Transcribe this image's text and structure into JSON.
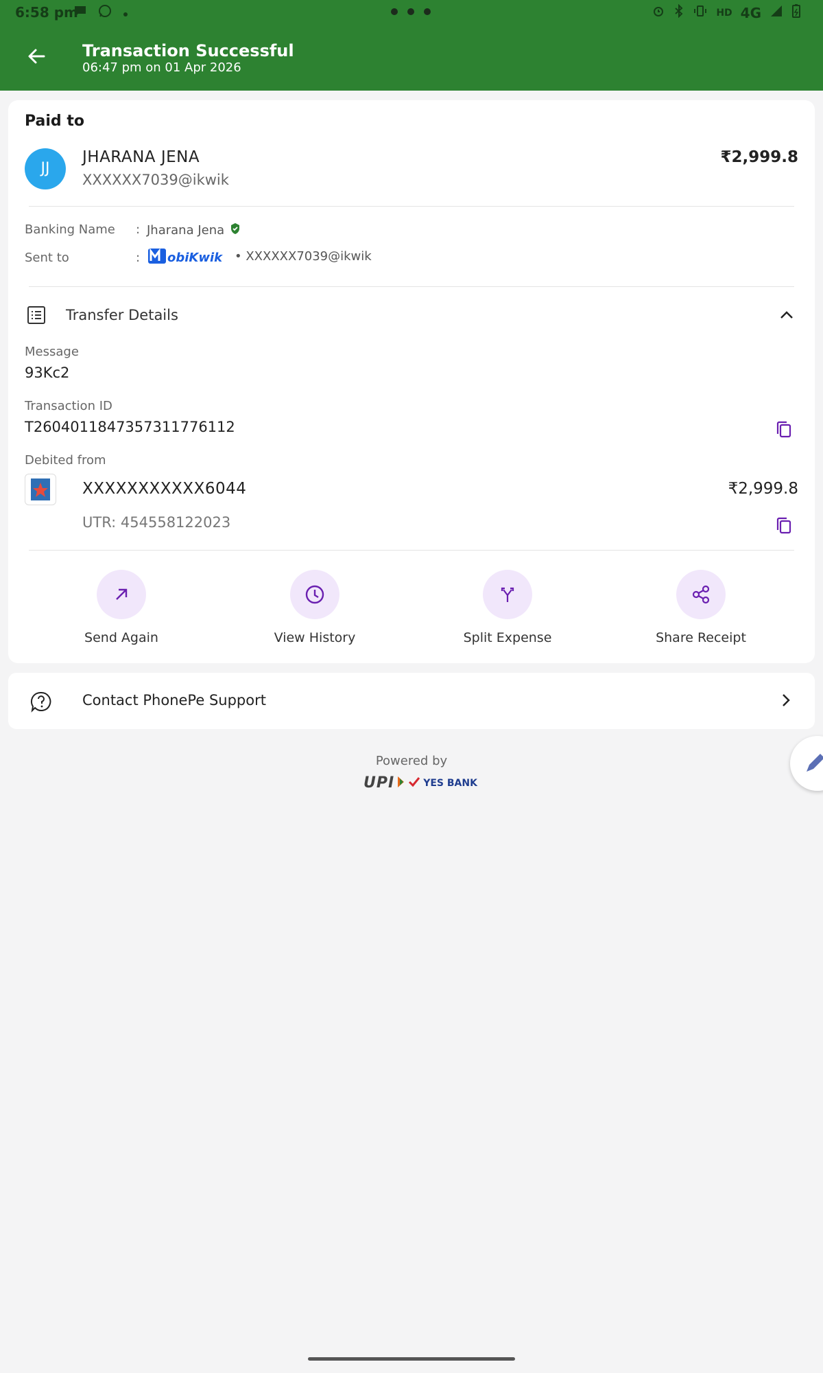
{
  "status_bar": {
    "time": "6:58 pm",
    "network": "4G",
    "hd": "HD"
  },
  "header": {
    "title": "Transaction Successful",
    "subtitle": "06:47 pm on 01 Apr 2026",
    "background_color": "#2d8231"
  },
  "payee": {
    "section_label": "Paid to",
    "initials": "JJ",
    "name": "JHARANA JENA",
    "vpa": "XXXXXX7039@ikwik",
    "amount": "₹2,999.8"
  },
  "details": {
    "banking_name_label": "Banking Name",
    "banking_name_value": "Jharana Jena",
    "sent_to_label": "Sent to",
    "sent_to_logo": "MobiKwik",
    "sent_to_value": "• XXXXXX7039@ikwik",
    "colon": ":"
  },
  "transfer_details": {
    "title": "Transfer Details",
    "message_label": "Message",
    "message_value": "93Kc2",
    "txn_id_label": "Transaction ID",
    "txn_id_value": "T2604011847357311776112",
    "debited_from_label": "Debited from",
    "account": "XXXXXXXXXXX6044",
    "account_amount": "₹2,999.8",
    "utr": "UTR: 454558122023"
  },
  "actions": [
    {
      "label": "Send Again",
      "icon": "arrow-up-right-icon"
    },
    {
      "label": "View History",
      "icon": "clock-icon"
    },
    {
      "label": "Split Expense",
      "icon": "split-icon"
    },
    {
      "label": "Share Receipt",
      "icon": "share-icon"
    }
  ],
  "support": {
    "label": "Contact PhonePe Support"
  },
  "footer": {
    "powered_by": "Powered by",
    "upi": "UPI",
    "bank": "YES BANK"
  },
  "accent_color": "#6a1fb0"
}
